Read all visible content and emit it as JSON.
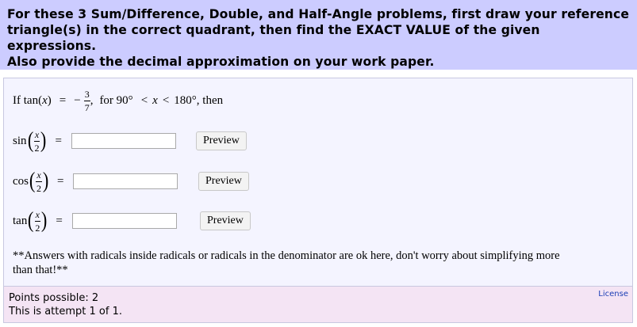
{
  "intro": {
    "line1": "For these 3 Sum/Difference, Double, and Half-Angle problems, first draw your reference",
    "line2": "triangle(s) in the correct quadrant, then find the EXACT VALUE of the given expressions.",
    "line3": "Also provide the decimal approximation on your work paper."
  },
  "question": {
    "stem": {
      "prefix": "If tan",
      "var": "x",
      "equals": "=",
      "minus": "−",
      "num": "3",
      "den": "7",
      "comma": ",",
      "for_text": "for 90°",
      "lt1": "<",
      "lt2": "<",
      "upper": "180°",
      "then": ", then"
    },
    "rows": [
      {
        "func": "sin",
        "num": "x",
        "den": "2",
        "equals": "=",
        "value": "",
        "button": "Preview"
      },
      {
        "func": "cos",
        "num": "x",
        "den": "2",
        "equals": "=",
        "value": "",
        "button": "Preview"
      },
      {
        "func": "tan",
        "num": "x",
        "den": "2",
        "equals": "=",
        "value": "",
        "button": "Preview"
      }
    ],
    "note_line1": "**Answers with radicals inside radicals or radicals in the denominator are ok here, don't worry about simplifying more",
    "note_line2": "than that!**"
  },
  "footer": {
    "points": "Points possible: 2",
    "attempt": "This is attempt 1 of 1.",
    "license": "License"
  },
  "colors": {
    "intro_bg": "#ccccff",
    "question_bg": "#f4f4ff",
    "footer_bg": "#f4e4f4",
    "link": "#1a3db5"
  }
}
